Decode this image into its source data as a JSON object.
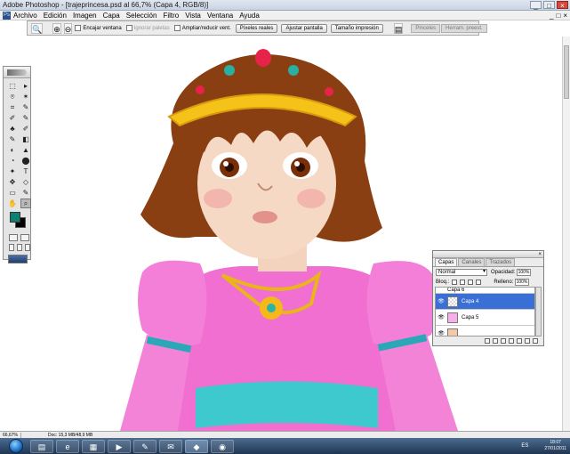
{
  "window": {
    "title": "Adobe Photoshop - [trajeprincesa.psd al 66,7% (Capa 4, RGB/8)]",
    "minimize": "_",
    "maximize": "□",
    "close": "×"
  },
  "menu": {
    "items": [
      "Archivo",
      "Edición",
      "Imagen",
      "Capa",
      "Selección",
      "Filtro",
      "Vista",
      "Ventana",
      "Ayuda"
    ],
    "mdi": [
      "_",
      "□",
      "×"
    ]
  },
  "options": {
    "tool_icon": "zoom-tool-icon",
    "checks": [
      {
        "label": "Encajar ventana",
        "checked": false,
        "enabled": true
      },
      {
        "label": "Ignorar paletas",
        "checked": false,
        "enabled": false
      },
      {
        "label": "Ampliar/reducir vent.",
        "checked": false,
        "enabled": true
      }
    ],
    "buttons": [
      "Píxeles reales",
      "Ajustar pantalla",
      "Tamaño impresión"
    ],
    "well_tabs": [
      "Pinceles",
      "Herram. preest."
    ]
  },
  "toolbox": {
    "tools": [
      "⬚",
      "▸",
      "⌾",
      "✶",
      "⌗",
      "✎",
      "✐",
      "✎",
      "♣",
      "✐",
      "✎",
      "◧",
      "◐",
      "▲",
      "◔",
      "⬤",
      "✦",
      "T",
      "✥",
      "◇",
      "▭",
      "✎",
      "✋",
      "⌕"
    ],
    "selected_index": 23,
    "foreground_color": "#0f7f73",
    "background_color": "#000000"
  },
  "layers": {
    "tabs": [
      "Capas",
      "Canales",
      "Trazados"
    ],
    "blend_mode": "Normal",
    "opacity_label": "Opacidad:",
    "opacity_value": "100%",
    "lock_label": "Bloq.:",
    "fill_label": "Relleno:",
    "fill_value": "100%",
    "items": [
      {
        "name": "Capa 6",
        "visible": true,
        "active": false
      },
      {
        "name": "Capa 4",
        "visible": true,
        "active": true
      },
      {
        "name": "Capa 5",
        "visible": true,
        "active": false
      },
      {
        "name": "",
        "visible": true,
        "active": false
      }
    ]
  },
  "status": {
    "zoom": "66,67%",
    "doc": "Doc: 15,3 MB/48,9 MB"
  },
  "taskbar": {
    "apps": [
      "folder-icon",
      "ie-icon",
      "explorer-icon",
      "media-icon",
      "paint-icon",
      "mail-icon",
      "photoshop-icon",
      "chrome-icon"
    ],
    "lang": "ES",
    "time": "18:07",
    "date": "27/01/2011"
  },
  "colors": {
    "hair": "#8a3f12",
    "skin": "#f6d9c4",
    "dress": "#f06fd0",
    "sash": "#3ec9cf",
    "tiara": "#f5c21a"
  }
}
